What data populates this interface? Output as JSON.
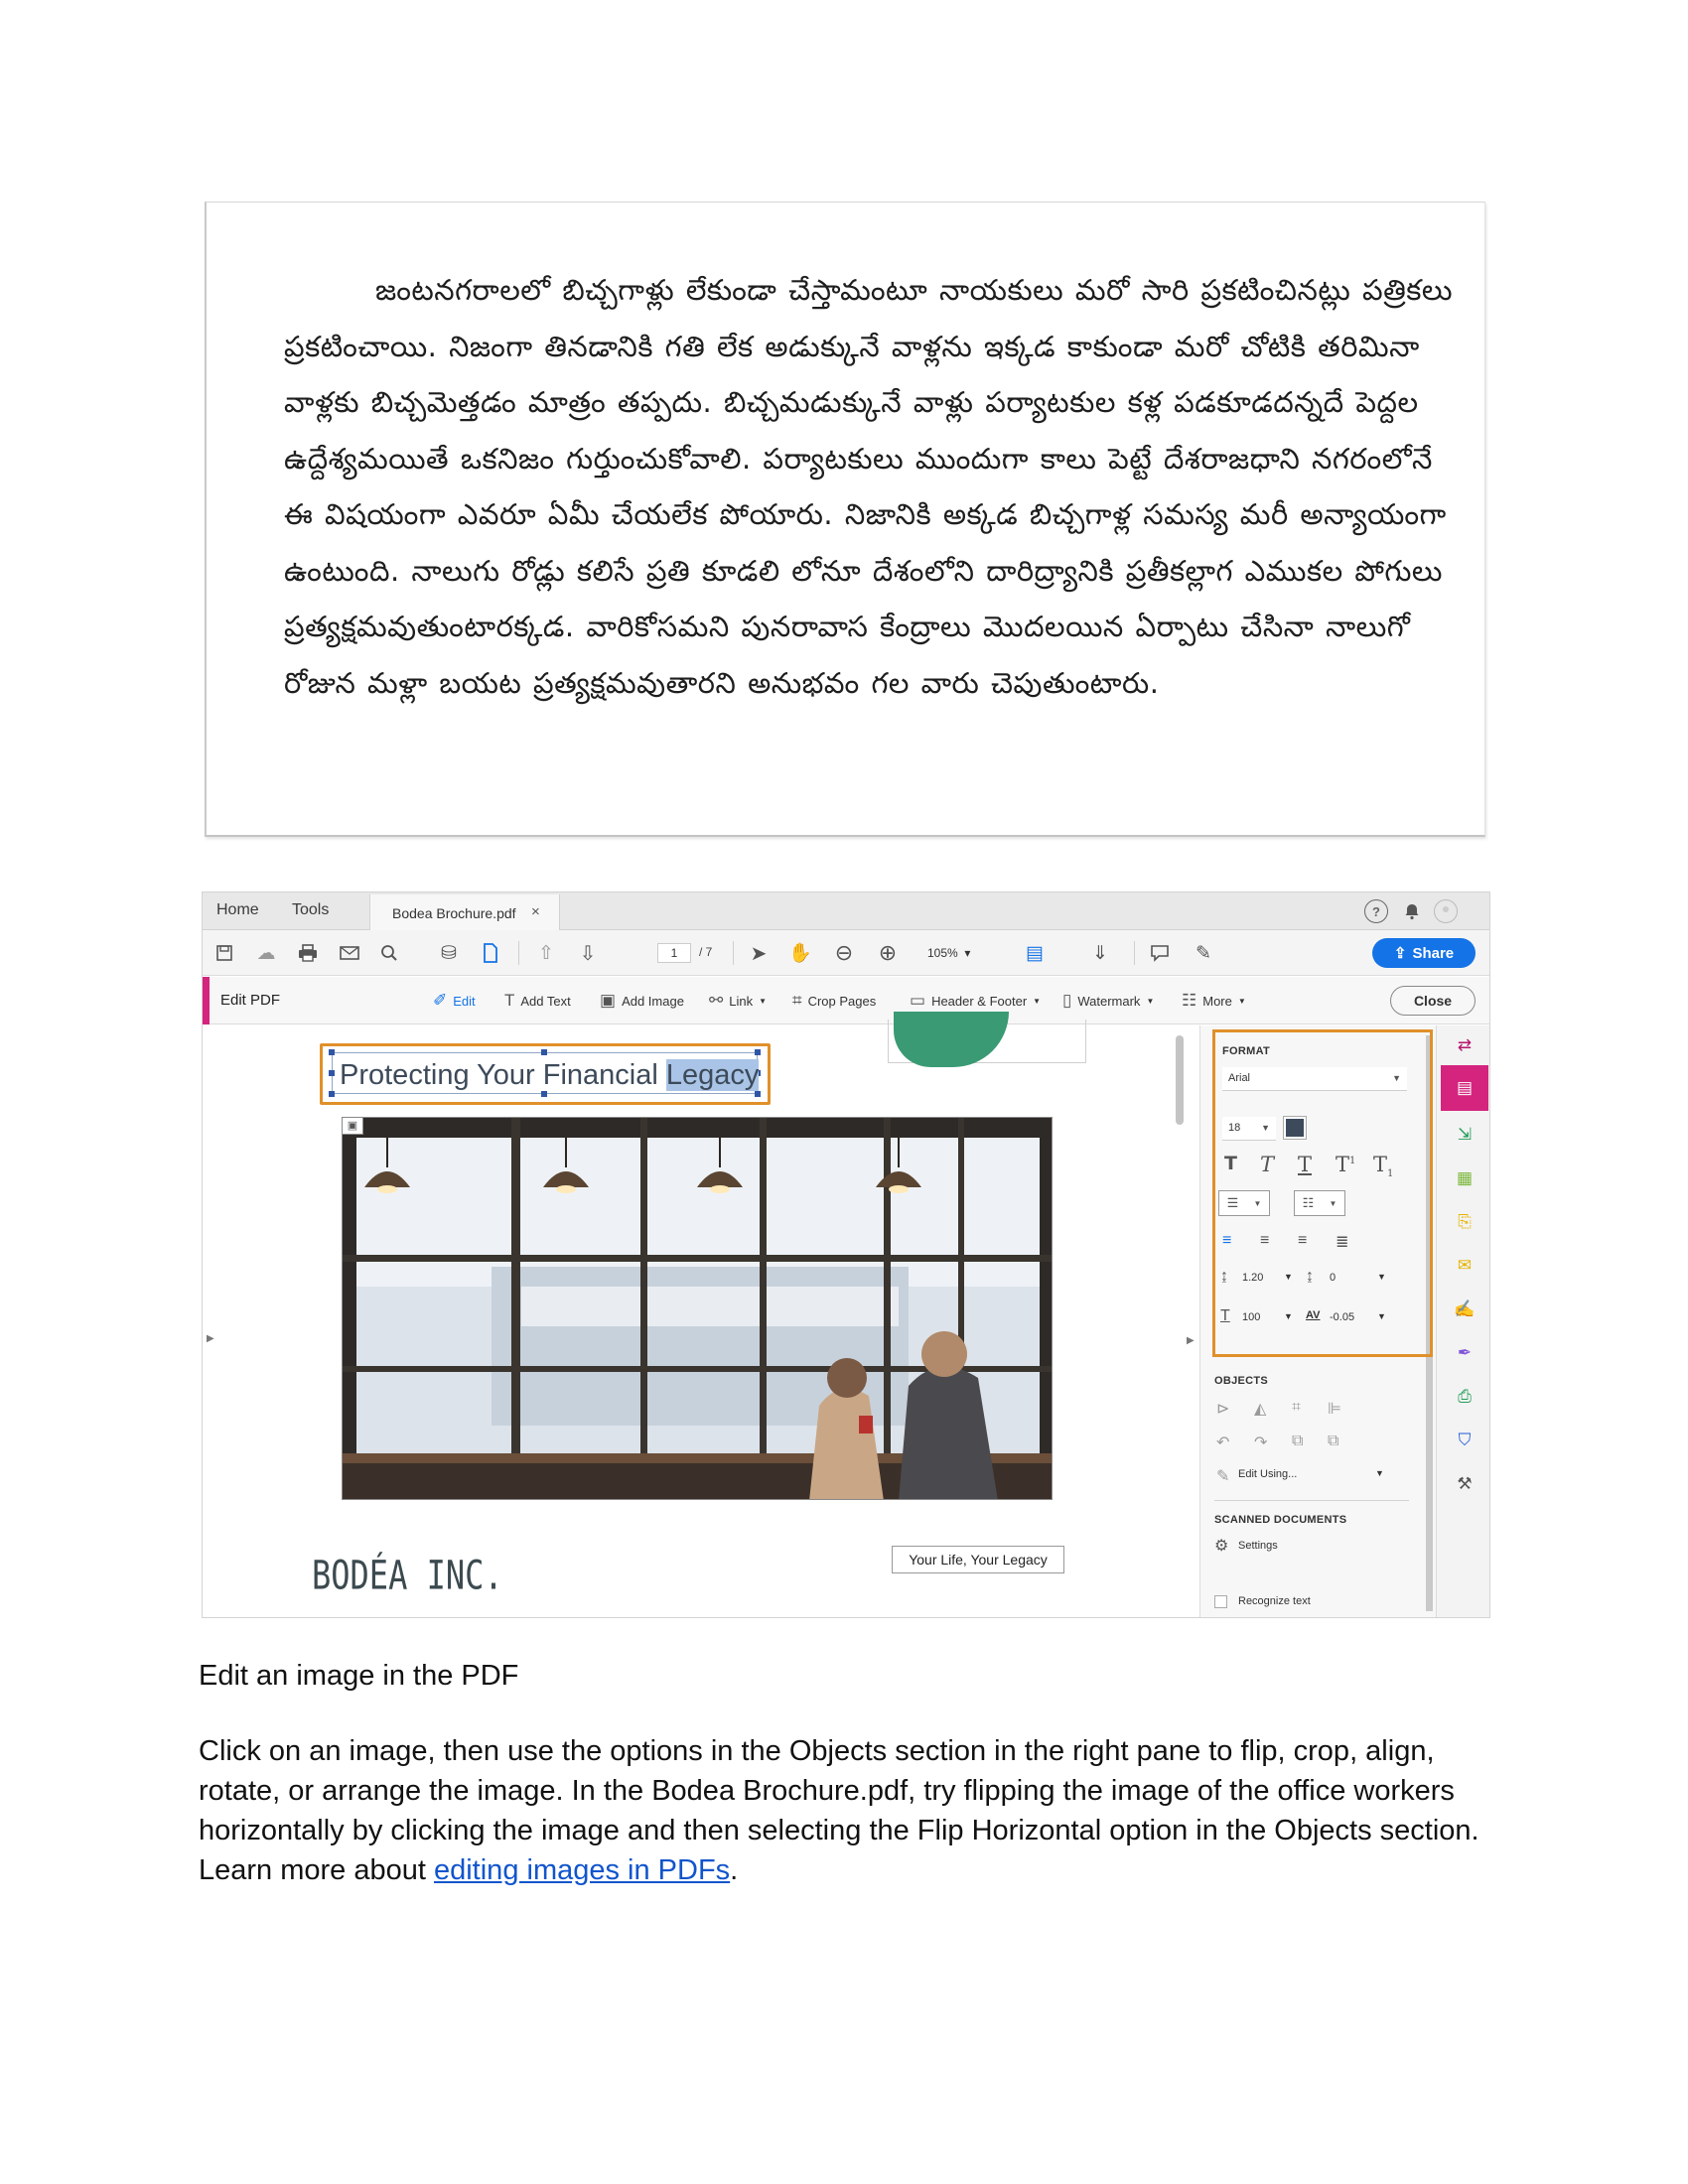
{
  "telugu_paragraph": "జంటనగరాలలో బిచ్చగాళ్లు లేకుండా చేస్తామంటూ నాయకులు మరో సారి ప్రకటించినట్లు పత్రికలు ప్రకటించాయి. నిజంగా తినడానికి గతి లేక అడుక్కునే వాళ్లను ఇక్కడ కాకుండా మరో చోటికి తరిమినా వాళ్లకు బిచ్చమెత్తడం మాత్రం తప్పదు. బిచ్చమడుక్కునే వాళ్లు పర్యాటకుల కళ్ల పడకూడదన్నదే పెద్దల ఉద్దేశ్యమయితే ఒకనిజం గుర్తుంచుకోవాలి. పర్యాటకులు ముందుగా కాలు పెట్టే దేశరాజధాని నగరంలోనే ఈ విషయంగా ఎవరూ ఏమీ చేయలేక పోయారు. నిజానికి అక్కడ బిచ్చగాళ్ల సమస్య మరీ అన్యాయంగా ఉంటుంది. నాలుగు రోడ్లు కలిసే ప్రతి కూడలి లోనూ దేశంలోని దారిద్ర్యానికి ప్రతీకల్లాగ ఎముకల పోగులు ప్రత్యక్షమవుతుంటారక్కడ. వారికోసమని పునరావాస కేంద్రాలు మొదలయిన ఏర్పాటు చేసినా నాలుగో రోజున మళ్లా బయట ప్రత్యక్షమవుతారని అనుభవం గల వారు చెపుతుంటారు.",
  "acrobat": {
    "tabs": {
      "home": "Home",
      "tools": "Tools",
      "document": "Bodea Brochure.pdf",
      "close_glyph": "×"
    },
    "toolbar": {
      "page_current": "1",
      "page_total": "/ 7",
      "zoom": "105%",
      "zoom_caret": "▾",
      "share": "Share"
    },
    "edit_bar": {
      "title": "Edit PDF",
      "items": [
        {
          "label": "Edit",
          "icon": "edit-icon"
        },
        {
          "label": "Add Text",
          "icon": "add-text-icon"
        },
        {
          "label": "Add Image",
          "icon": "add-image-icon"
        },
        {
          "label": "Link",
          "icon": "link-icon"
        },
        {
          "label": "Crop Pages",
          "icon": "crop-pages-icon"
        },
        {
          "label": "Header & Footer",
          "icon": "header-footer-icon"
        },
        {
          "label": "Watermark",
          "icon": "watermark-icon"
        },
        {
          "label": "More",
          "icon": "more-icon"
        }
      ],
      "close": "Close"
    },
    "document": {
      "heading_plain": "Protecting Your Financial ",
      "heading_selected": "Legacy",
      "tagline": "Your Life, Your Legacy",
      "logo_text": "BODÉA INC."
    },
    "format_panel": {
      "heading": "FORMAT",
      "font": "Arial",
      "font_size": "18",
      "text_color": "#3c4a5c",
      "style_glyphs": [
        "T",
        "T",
        "T",
        "T",
        "T"
      ],
      "line_spacing": "1.20",
      "paragraph_spacing": "0",
      "horizontal_scale": "100",
      "char_spacing": "-0.05"
    },
    "objects_panel": {
      "heading": "OBJECTS",
      "edit_using": "Edit Using..."
    },
    "scanned_panel": {
      "heading": "SCANNED DOCUMENTS",
      "settings": "Settings",
      "recognize": "Recognize text"
    },
    "accent_color": "#d4247d",
    "highlight_color": "#e0902a",
    "share_color": "#1473e6"
  },
  "instructions": {
    "title": "Edit an image in the PDF",
    "body": "Click on an image, then use the options in the Objects section in the right pane to flip, crop, align, rotate, or arrange the image. In the Bodea Brochure.pdf, try flipping the image of the office workers horizontally by clicking the image and then selecting the Flip Horizontal option in the Objects section. Learn more about ",
    "link": "editing images in PDFs",
    "end": "."
  }
}
